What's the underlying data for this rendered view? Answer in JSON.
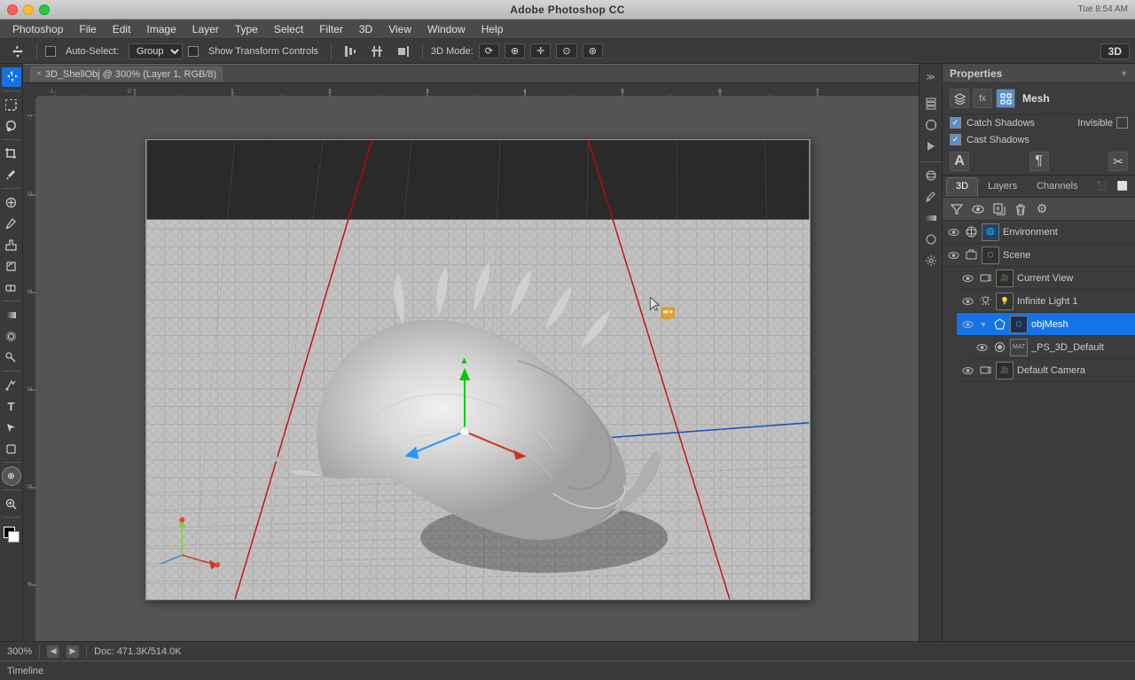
{
  "titlebar": {
    "title": "Adobe Photoshop CC",
    "time": "Tue 8:54 AM"
  },
  "menubar": {
    "items": [
      "Photoshop",
      "File",
      "Edit",
      "Image",
      "Layer",
      "Type",
      "Select",
      "Filter",
      "3D",
      "View",
      "Window",
      "Help"
    ]
  },
  "optionsbar": {
    "autoselect_label": "Auto-Select:",
    "autoselect_value": "Group",
    "show_transform": "Show Transform Controls",
    "mode_label": "3D Mode:",
    "mode_btn_labels": [
      "◎",
      "⊕",
      "✛",
      "⊙",
      "⊛"
    ]
  },
  "doc_tab": {
    "title": "3D_ShellObj @ 300% (Layer 1, RGB/8)",
    "close": "×"
  },
  "canvas": {
    "zoom": "300%",
    "doc_info": "Doc: 471.3K/514.0K"
  },
  "properties": {
    "title": "Properties",
    "section": "Mesh",
    "catch_shadows": "Catch Shadows",
    "cast_shadows": "Cast Shadows",
    "invisible": "Invisible"
  },
  "tabs3d": {
    "labels": [
      "3D",
      "Layers",
      "Channels"
    ]
  },
  "layers": {
    "toolbar_icons": [
      "≡",
      "□",
      "⬇",
      "⬆",
      "✕"
    ],
    "items": [
      {
        "id": "environment",
        "name": "Environment",
        "vis": true,
        "type": "env",
        "indent": 0,
        "expand": false
      },
      {
        "id": "scene",
        "name": "Scene",
        "vis": true,
        "type": "scene",
        "indent": 0,
        "expand": false
      },
      {
        "id": "currentview",
        "name": "Current View",
        "vis": true,
        "type": "cam",
        "indent": 1,
        "expand": false
      },
      {
        "id": "infinitelight1",
        "name": "Infinite Light 1",
        "vis": true,
        "type": "light",
        "indent": 1,
        "expand": false
      },
      {
        "id": "objmesh",
        "name": "objMesh",
        "vis": true,
        "type": "mesh",
        "indent": 1,
        "expand": true,
        "selected": true
      },
      {
        "id": "ps3ddefault",
        "name": "_PS_3D_Default",
        "vis": true,
        "type": "mat",
        "indent": 2,
        "expand": false
      },
      {
        "id": "defaultcamera",
        "name": "Default Camera",
        "vis": true,
        "type": "cam",
        "indent": 1,
        "expand": false
      }
    ]
  },
  "bottom": {
    "zoom": "300%",
    "doc_size": "Doc: 471.3K/514.0K",
    "timeline": "Timeline"
  },
  "icons": {
    "eye": "👁",
    "mesh_icon": "⬡",
    "scene_icon": "🎬",
    "light_icon": "💡",
    "cam_icon": "📷",
    "mat_icon": "◈",
    "env_icon": "🌐"
  }
}
